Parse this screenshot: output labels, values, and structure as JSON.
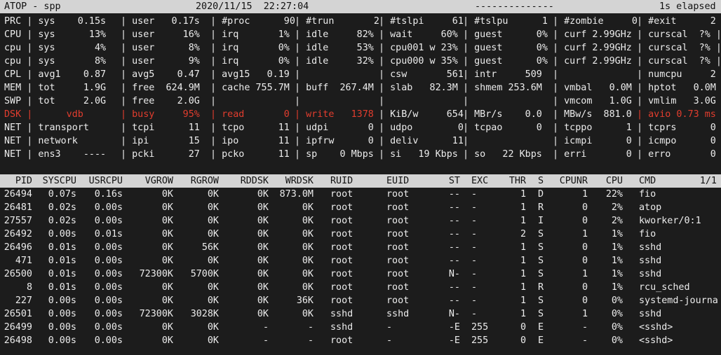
{
  "header": {
    "left": "ATOP - spp",
    "datetime": "2020/11/15  22:27:04",
    "dashes": "--------------",
    "elapsed": "1s elapsed"
  },
  "sys_rows": [
    {
      "cells": [
        "PRC | sys    0.15s",
        "| user   0.17s",
        "| #proc      90",
        "| #trun       2",
        "| #tslpi     61",
        "| #tslpu      1",
        "| #zombie     0",
        "| #exit      2 |"
      ]
    },
    {
      "cells": [
        "CPU | sys      13%",
        "| user     16%",
        "| irq       1%",
        "| idle     82%",
        "| wait     60%",
        "| guest      0%",
        "| curf 2.99GHz",
        "| curscal  ?% |"
      ]
    },
    {
      "cells": [
        "cpu | sys       4%",
        "| user      8%",
        "| irq       0%",
        "| idle     53%",
        "| cpu001 w 23%",
        "| guest      0%",
        "| curf 2.99GHz",
        "| curscal  ?% |"
      ]
    },
    {
      "cells": [
        "cpu | sys       8%",
        "| user      9%",
        "| irq       0%",
        "| idle     32%",
        "| cpu000 w 35%",
        "| guest      0%",
        "| curf 2.99GHz",
        "| curscal  ?% |"
      ]
    },
    {
      "cells": [
        "CPL | avg1    0.87",
        "| avg5    0.47",
        "| avg15   0.19",
        "|",
        "| csw       561",
        "| intr     509",
        "|",
        "| numcpu     2 |"
      ]
    },
    {
      "cells": [
        "MEM | tot     1.9G",
        "| free  624.9M",
        "| cache 755.7M",
        "| buff  267.4M",
        "| slab   82.3M",
        "| shmem 253.6M",
        "| vmbal   0.0M",
        "| hptot   0.0M |"
      ]
    },
    {
      "cells": [
        "SWP | tot     2.0G",
        "| free    2.0G",
        "|",
        "|",
        "|",
        "|",
        "| vmcom   1.0G",
        "| vmlim   3.0G |"
      ]
    },
    {
      "cells": [
        "DSK |      vdb",
        "| busy     95%",
        "| read       0",
        "| write   1378",
        "| KiB/w     654",
        "| MBr/s    0.0",
        "| MBw/s  881.0",
        "| avio 0.73 ms |"
      ],
      "red_cells": [
        0,
        1,
        2,
        3,
        7
      ]
    },
    {
      "cells": [
        "NET | transport",
        "| tcpi      11",
        "| tcpo      11",
        "| udpi       0",
        "| udpo        0",
        "| tcpao      0",
        "| tcppo      1",
        "| tcprs      0 |"
      ]
    },
    {
      "cells": [
        "NET | network",
        "| ipi       15",
        "| ipo       11",
        "| ipfrw      0",
        "| deliv      11",
        "|",
        "| icmpi      0",
        "| icmpo      0 |"
      ]
    },
    {
      "cells": [
        "NET | ens3    ----",
        "| pcki      27",
        "| pcko      11",
        "| sp    0 Mbps",
        "| si   19 Kbps",
        "| so   22 Kbps",
        "| erri       0",
        "| erro       0 |"
      ]
    }
  ],
  "columns": [
    "PID",
    "SYSCPU",
    "USRCPU",
    "VGROW",
    "RGROW",
    "RDDSK",
    "WRDSK",
    "RUID",
    "EUID",
    "ST",
    "EXC",
    "THR",
    "S",
    "CPUNR",
    "CPU",
    "CMD",
    "1/1"
  ],
  "processes": [
    [
      "26494",
      "0.07s",
      "0.16s",
      "0K",
      "0K",
      "0K",
      "873.0M",
      "root",
      "root",
      "--",
      "-",
      "1",
      "D",
      "1",
      "22%",
      "fio"
    ],
    [
      "26481",
      "0.02s",
      "0.00s",
      "0K",
      "0K",
      "0K",
      "0K",
      "root",
      "root",
      "--",
      "-",
      "1",
      "R",
      "0",
      "2%",
      "atop"
    ],
    [
      "27557",
      "0.02s",
      "0.00s",
      "0K",
      "0K",
      "0K",
      "0K",
      "root",
      "root",
      "--",
      "-",
      "1",
      "I",
      "0",
      "2%",
      "kworker/0:1"
    ],
    [
      "26492",
      "0.00s",
      "0.01s",
      "0K",
      "0K",
      "0K",
      "0K",
      "root",
      "root",
      "--",
      "-",
      "2",
      "S",
      "1",
      "1%",
      "fio"
    ],
    [
      "26496",
      "0.01s",
      "0.00s",
      "0K",
      "56K",
      "0K",
      "0K",
      "root",
      "root",
      "--",
      "-",
      "1",
      "S",
      "0",
      "1%",
      "sshd"
    ],
    [
      "471",
      "0.01s",
      "0.00s",
      "0K",
      "0K",
      "0K",
      "0K",
      "root",
      "root",
      "--",
      "-",
      "1",
      "S",
      "0",
      "1%",
      "sshd"
    ],
    [
      "26500",
      "0.01s",
      "0.00s",
      "72300K",
      "5700K",
      "0K",
      "0K",
      "root",
      "root",
      "N-",
      "-",
      "1",
      "S",
      "1",
      "1%",
      "sshd"
    ],
    [
      "8",
      "0.01s",
      "0.00s",
      "0K",
      "0K",
      "0K",
      "0K",
      "root",
      "root",
      "--",
      "-",
      "1",
      "R",
      "0",
      "1%",
      "rcu_sched"
    ],
    [
      "227",
      "0.00s",
      "0.00s",
      "0K",
      "0K",
      "0K",
      "36K",
      "root",
      "root",
      "--",
      "-",
      "1",
      "S",
      "0",
      "0%",
      "systemd-journa"
    ],
    [
      "26501",
      "0.00s",
      "0.00s",
      "72300K",
      "3028K",
      "0K",
      "0K",
      "sshd",
      "sshd",
      "N-",
      "-",
      "1",
      "S",
      "1",
      "0%",
      "sshd"
    ],
    [
      "26499",
      "0.00s",
      "0.00s",
      "0K",
      "0K",
      "-",
      "-",
      "sshd",
      "-",
      "-E",
      "255",
      "0",
      "E",
      "-",
      "0%",
      "<sshd>"
    ],
    [
      "26498",
      "0.00s",
      "0.00s",
      "0K",
      "0K",
      "-",
      "-",
      "root",
      "-",
      "-E",
      "255",
      "0",
      "E",
      "-",
      "0%",
      "<sshd>"
    ]
  ]
}
